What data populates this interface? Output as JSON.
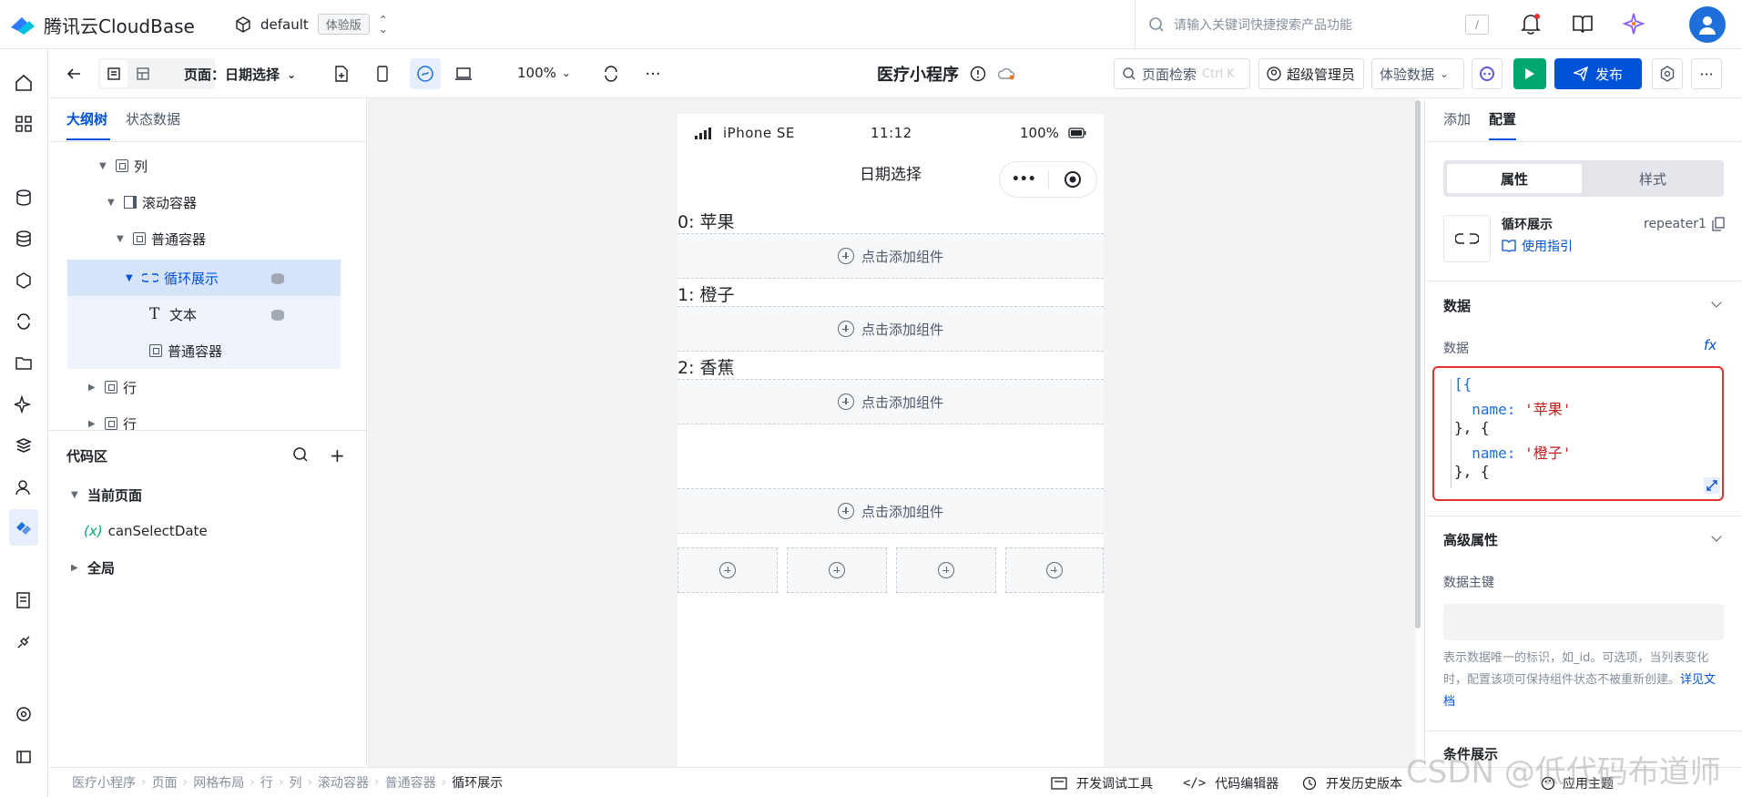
{
  "app": {
    "brand": "腾讯云CloudBase",
    "env_name": "default",
    "env_badge": "体验版",
    "search_placeholder": "请输入关键词快捷搜索产品功能",
    "search_shortcut": "/"
  },
  "toolbar": {
    "page_label": "页面：日期选择",
    "zoom": "100%",
    "app_title": "医疗小程序",
    "page_search": "页面检索",
    "page_search_shortcut": "Ctrl K",
    "role": "超级管理员",
    "data_mode": "体验数据",
    "publish": "发布"
  },
  "left_panel": {
    "tabs": [
      "大纲树",
      "状态数据"
    ],
    "tree": [
      {
        "label": "列"
      },
      {
        "label": "滚动容器"
      },
      {
        "label": "普通容器"
      },
      {
        "label": "循环展示"
      },
      {
        "label": "文本"
      },
      {
        "label": "普通容器"
      },
      {
        "label": "行"
      },
      {
        "label": "行"
      }
    ],
    "code_area": {
      "title": "代码区",
      "current_page": "当前页面",
      "variable_prefix": "(x)",
      "variable": "canSelectDate",
      "global": "全局"
    }
  },
  "phone": {
    "carrier": "iPhone SE",
    "time": "11:12",
    "battery": "100%",
    "nav_title": "日期选择",
    "items": [
      "0: 苹果",
      "1: 橙子",
      "2: 香蕉"
    ],
    "add_component": "点击添加组件"
  },
  "right_panel": {
    "tabs": [
      "添加",
      "配置"
    ],
    "segments": [
      "属性",
      "样式"
    ],
    "component_name": "循环展示",
    "component_id": "repeater1",
    "guide_link": "使用指引",
    "data_section": "数据",
    "data_label": "数据",
    "fx": "fx",
    "code_lines": [
      {
        "text": "[{",
        "kind": "k"
      },
      {
        "text": "  name: ",
        "kind": "k",
        "value": "'苹果'"
      },
      {
        "text": "}, {",
        "kind": "p"
      },
      {
        "text": "  name: ",
        "kind": "k",
        "value": "'橙子'"
      },
      {
        "text": "}, {",
        "kind": "p"
      }
    ],
    "advanced_section": "高级属性",
    "key_label": "数据主键",
    "key_hint": "表示数据唯一的标识，如_id。可选项，当列表变化时，配置该项可保持组件状态不被重新创建。",
    "doc_link": "详见文档",
    "condition_section": "条件展示"
  },
  "status_bar": {
    "breadcrumb": [
      "医疗小程序",
      "页面",
      "网格布局",
      "行",
      "列",
      "滚动容器",
      "普通容器",
      "循环展示"
    ],
    "dev_tools": "开发调试工具",
    "code_editor": "代码编辑器",
    "history": "开发历史版本",
    "theme": "应用主题"
  },
  "watermark": "CSDN @低代码布道师",
  "colors": {
    "primary": "#0052d9",
    "publish_bg": "#0052d9",
    "run_bg": "#00a870",
    "highlight_border": "#e5312e"
  }
}
